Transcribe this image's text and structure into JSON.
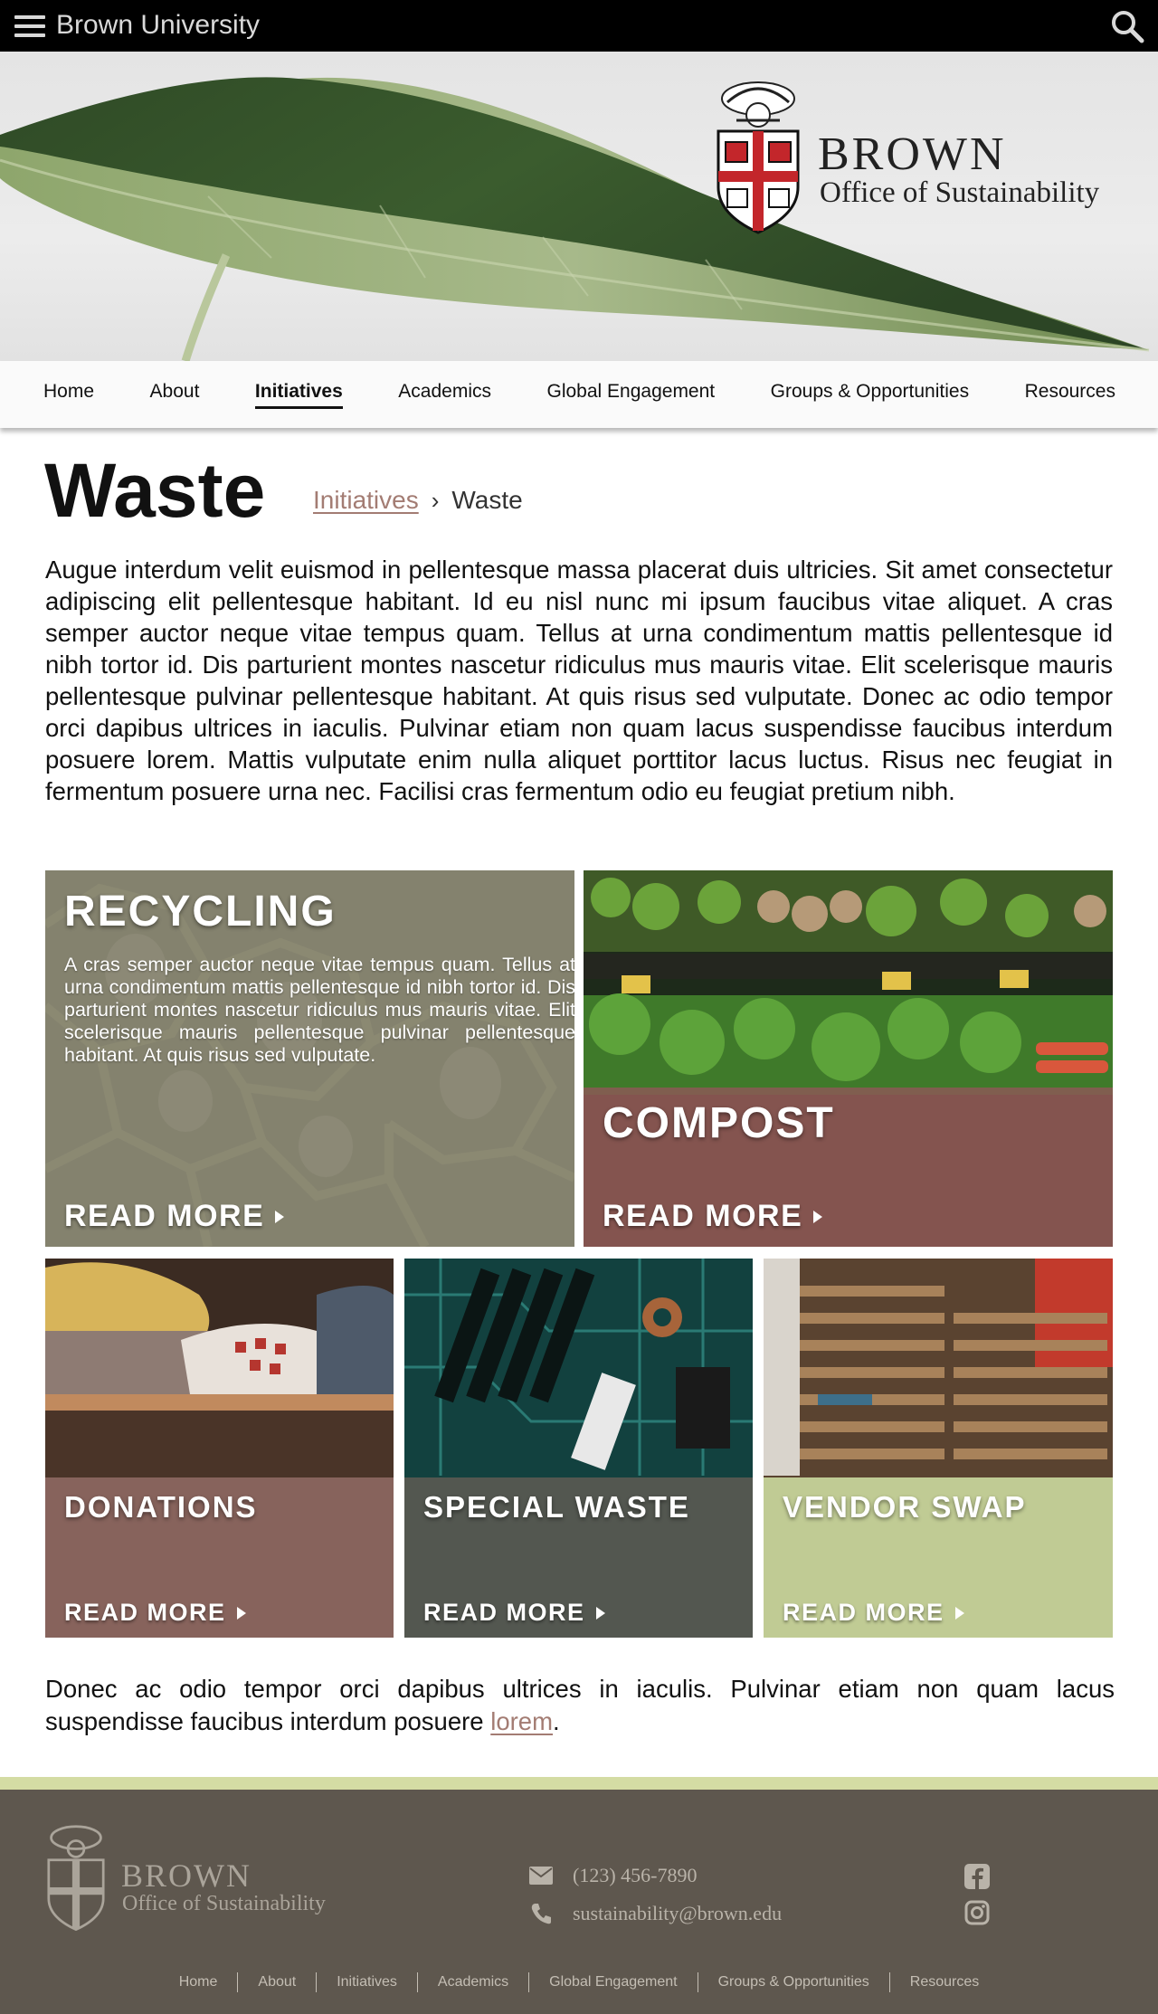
{
  "topbar": {
    "site_name": "Brown University"
  },
  "hero": {
    "brand_name": "BROWN",
    "office_name": "Office of Sustainability"
  },
  "nav": {
    "items": [
      {
        "label": "Home"
      },
      {
        "label": "About"
      },
      {
        "label": "Initiatives",
        "active": true
      },
      {
        "label": "Academics"
      },
      {
        "label": "Global Engagement"
      },
      {
        "label": "Groups & Opportunities"
      },
      {
        "label": "Resources"
      }
    ]
  },
  "page": {
    "title": "Waste",
    "breadcrumb": {
      "parent": "Initiatives",
      "separator": "›",
      "current": "Waste"
    },
    "intro": "Augue interdum velit euismod in pellentesque massa placerat duis ultricies. Sit amet consectetur adipiscing elit pellentesque habitant. Id eu nisl nunc mi ipsum faucibus vitae aliquet. A cras semper auctor neque vitae tempus quam. Tellus at urna condimentum mattis pellentesque id nibh tortor id. Dis parturient montes nascetur ridiculus mus mauris vitae. Elit scelerisque mauris pellentesque pulvinar pellentesque habitant. At quis risus sed vulputate. Donec ac odio tempor orci dapibus ultrices in iaculis. Pulvinar etiam non quam lacus suspendisse faucibus interdum posuere lorem. Mattis vulputate enim nulla aliquet porttitor lacus luctus. Risus nec feugiat in fermentum posuere urna nec. Facilisi cras fermentum odio eu feugiat pretium nibh.",
    "outro_text": "Donec ac odio tempor orci dapibus ultrices in iaculis. Pulvinar etiam non quam lacus suspendisse faucibus interdum posuere ",
    "outro_link": "lorem",
    "outro_end": "."
  },
  "cards": {
    "read_more": "READ MORE",
    "recycling": {
      "title": "RECYCLING",
      "description": "A cras semper auctor neque vitae tempus quam. Tellus at urna condimentum mattis pellentesque id nibh tortor id. Dis parturient montes nascetur ridiculus mus mauris vitae. Elit scelerisque mauris pellentesque pulvinar pellentesque habitant. At quis risus sed vulputate.",
      "overlay_color": "#8b8676"
    },
    "compost": {
      "title": "COMPOST",
      "overlay_color": "#8a5a54"
    },
    "donations": {
      "title": "DONATIONS",
      "overlay_color": "#8e6862"
    },
    "special_waste": {
      "title": "SPECIAL WASTE",
      "overlay_color": "#5b5a52"
    },
    "vendor_swap": {
      "title": "VENDOR SWAP",
      "overlay_color": "#c9d79d"
    }
  },
  "footer": {
    "brand_name": "BROWN",
    "office_name": "Office of Sustainability",
    "phone": "(123) 456-7890",
    "email": "sustainability@brown.edu",
    "nav": [
      "Home",
      "About",
      "Initiatives",
      "Academics",
      "Global Engagement",
      "Groups & Opportunities",
      "Resources"
    ],
    "bg_color": "#5e574e",
    "stripe_color": "#d4dca4"
  },
  "colors": {
    "accent_link": "#a37c73",
    "topbar": "#000000"
  }
}
